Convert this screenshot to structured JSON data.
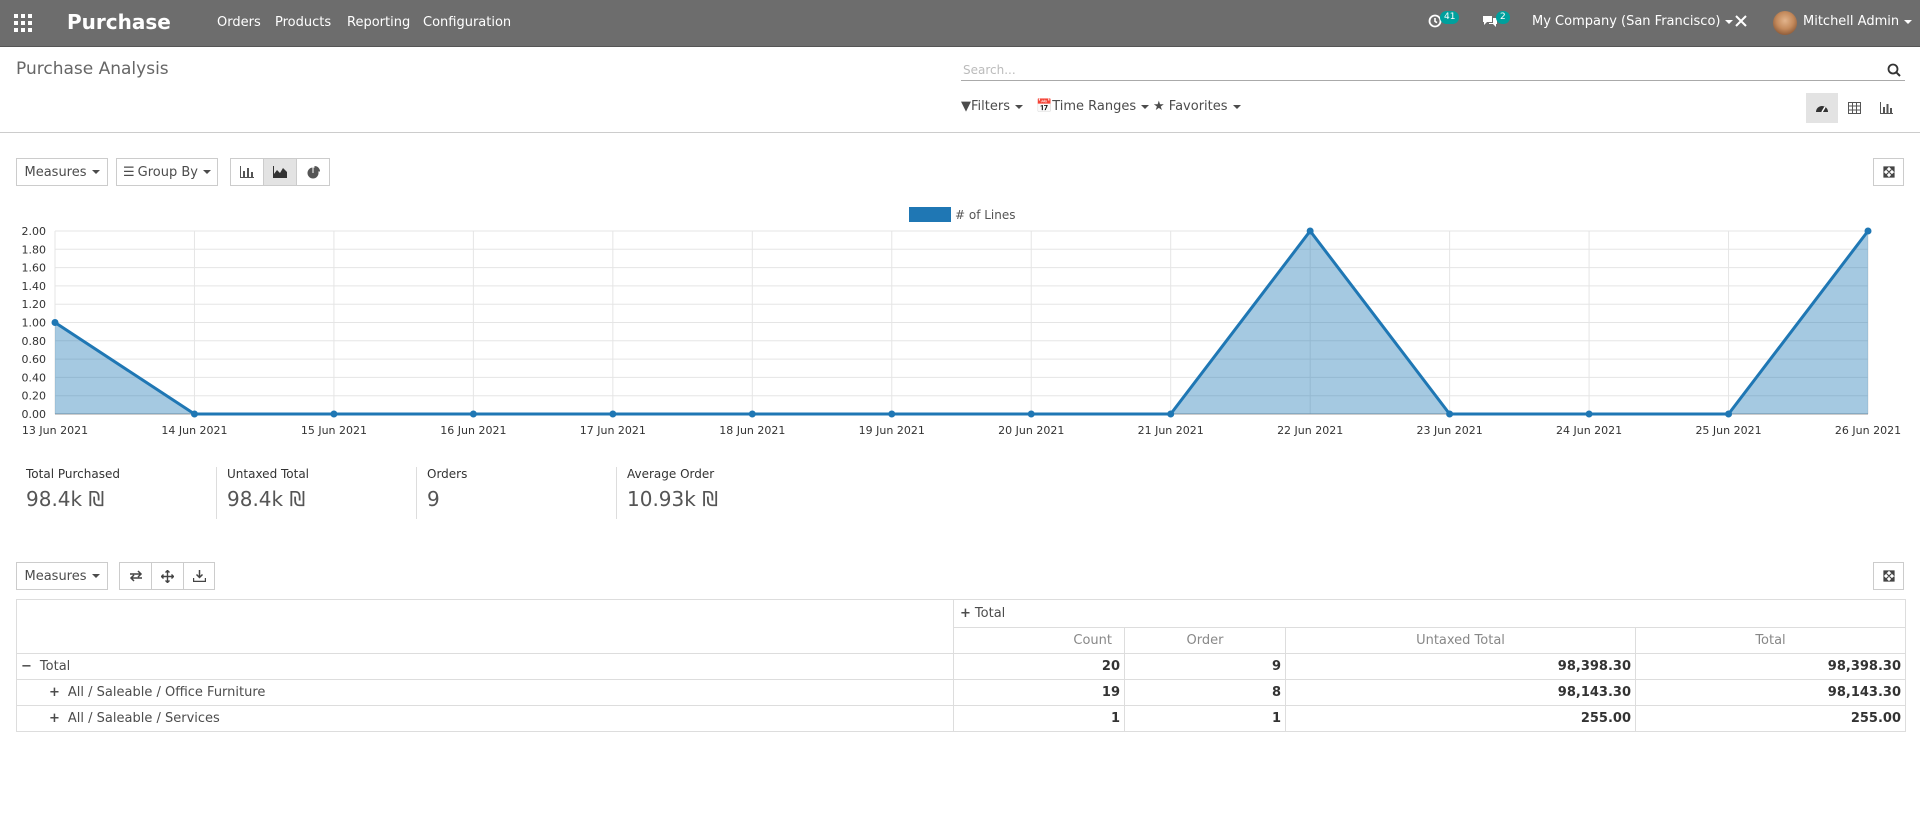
{
  "app": {
    "brand": "Purchase"
  },
  "nav": {
    "menus": [
      "Orders",
      "Products",
      "Reporting",
      "Configuration"
    ],
    "activity_count": "41",
    "message_count": "2",
    "company": "My Company (San Francisco)",
    "user": "Mitchell Admin"
  },
  "page": {
    "title": "Purchase Analysis"
  },
  "search": {
    "placeholder": "Search..."
  },
  "filters": {
    "filters": "Filters",
    "time_ranges": "Time Ranges",
    "favorites": "Favorites"
  },
  "graph_toolbar": {
    "measures": "Measures",
    "group_by": "Group By"
  },
  "chart_data": {
    "type": "area",
    "x": [
      "13 Jun 2021",
      "14 Jun 2021",
      "15 Jun 2021",
      "16 Jun 2021",
      "17 Jun 2021",
      "18 Jun 2021",
      "19 Jun 2021",
      "20 Jun 2021",
      "21 Jun 2021",
      "22 Jun 2021",
      "23 Jun 2021",
      "24 Jun 2021",
      "25 Jun 2021",
      "26 Jun 2021"
    ],
    "series": [
      {
        "name": "# of Lines",
        "values": [
          1,
          0,
          0,
          0,
          0,
          0,
          0,
          0,
          0,
          2,
          0,
          0,
          0,
          2
        ]
      }
    ],
    "ylim": [
      0,
      2
    ],
    "yticks": [
      "0.00",
      "0.20",
      "0.40",
      "0.60",
      "0.80",
      "1.00",
      "1.20",
      "1.40",
      "1.60",
      "1.80",
      "2.00"
    ],
    "grid": true,
    "legend": "top-center",
    "color": "#1f77b4"
  },
  "kpis": [
    {
      "label": "Total Purchased",
      "value": "98.4k ₪"
    },
    {
      "label": "Untaxed Total",
      "value": "98.4k ₪"
    },
    {
      "label": "Orders",
      "value": "9"
    },
    {
      "label": "Average Order",
      "value": "10.93k ₪"
    }
  ],
  "pivot": {
    "measures": "Measures",
    "col_header": "Total",
    "measure_headers": [
      "Count",
      "Order",
      "Untaxed Total",
      "Total"
    ],
    "rows": [
      {
        "label": "Total",
        "expanded": true,
        "values": [
          "20",
          "9",
          "98,398.30",
          "98,398.30"
        ]
      },
      {
        "label": "All / Saleable / Office Furniture",
        "expanded": false,
        "values": [
          "19",
          "8",
          "98,143.30",
          "98,143.30"
        ]
      },
      {
        "label": "All / Saleable / Services",
        "expanded": false,
        "values": [
          "1",
          "1",
          "255.00",
          "255.00"
        ]
      }
    ]
  }
}
